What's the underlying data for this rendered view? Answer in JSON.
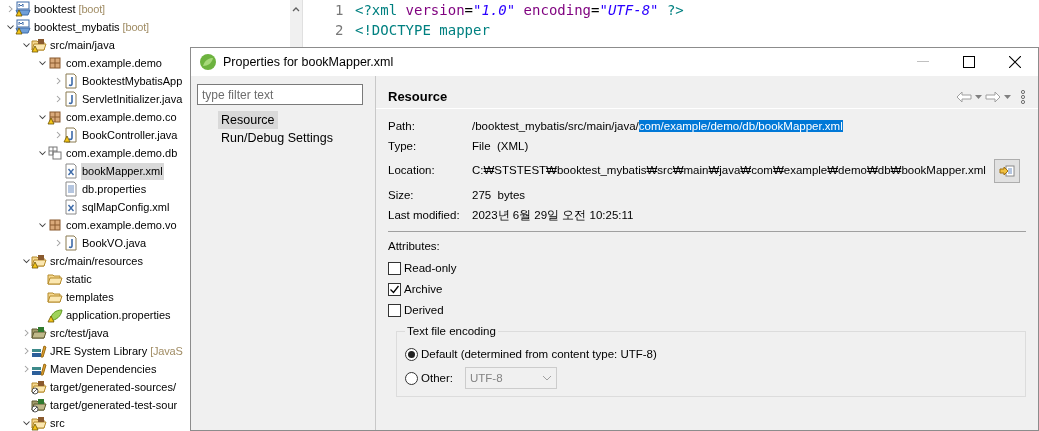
{
  "project_tree": {
    "items": [
      {
        "label": "booktest",
        "suffix": "[boot]",
        "kind": "project",
        "warning": true,
        "expanded": false,
        "selected": false
      },
      {
        "label": "booktest_mybatis",
        "suffix": "[boot]",
        "kind": "project",
        "warning": true,
        "expanded": true,
        "selected": false,
        "children": [
          {
            "label": "src/main/java",
            "kind": "source-folder",
            "warning": true,
            "expanded": true,
            "selected": false,
            "children": [
              {
                "label": "com.example.demo",
                "kind": "package",
                "warning": false,
                "expanded": true,
                "selected": false,
                "children": [
                  {
                    "label": "BooktestMybatisApp",
                    "kind": "java",
                    "warning": false,
                    "expanded": false,
                    "selected": false
                  },
                  {
                    "label": "ServletInitializer.java",
                    "kind": "java",
                    "warning": false,
                    "expanded": false,
                    "selected": false
                  }
                ]
              },
              {
                "label": "com.example.demo.co",
                "kind": "package",
                "warning": true,
                "expanded": true,
                "selected": false,
                "children": [
                  {
                    "label": "BookController.java",
                    "kind": "java",
                    "warning": true,
                    "expanded": false,
                    "selected": false
                  }
                ]
              },
              {
                "label": "com.example.demo.db",
                "kind": "resource-package",
                "warning": false,
                "expanded": true,
                "selected": false,
                "children": [
                  {
                    "label": "bookMapper.xml",
                    "kind": "xml",
                    "warning": false,
                    "selected": true
                  },
                  {
                    "label": "db.properties",
                    "kind": "text",
                    "warning": false,
                    "selected": false
                  },
                  {
                    "label": "sqlMapConfig.xml",
                    "kind": "xml",
                    "warning": false,
                    "selected": false
                  }
                ]
              },
              {
                "label": "com.example.demo.vo",
                "kind": "package",
                "warning": false,
                "expanded": true,
                "selected": false,
                "children": [
                  {
                    "label": "BookVO.java",
                    "kind": "java",
                    "warning": false,
                    "expanded": false,
                    "selected": false
                  }
                ]
              }
            ]
          },
          {
            "label": "src/main/resources",
            "kind": "source-folder",
            "warning": true,
            "expanded": true,
            "selected": false,
            "children": [
              {
                "label": "static",
                "kind": "folder",
                "warning": false,
                "selected": false
              },
              {
                "label": "templates",
                "kind": "folder",
                "warning": false,
                "selected": false
              },
              {
                "label": "application.properties",
                "kind": "spring",
                "warning": true,
                "selected": false
              }
            ]
          },
          {
            "label": "src/test/java",
            "kind": "test-folder",
            "warning": false,
            "expanded": false,
            "selected": false
          },
          {
            "label": "JRE System Library",
            "suffix": "[JavaS",
            "kind": "library",
            "warning": false,
            "expanded": false,
            "selected": false
          },
          {
            "label": "Maven Dependencies",
            "kind": "library",
            "warning": false,
            "expanded": false,
            "selected": false
          },
          {
            "label": "target/generated-sources/",
            "kind": "source-folder-off",
            "warning": false,
            "selected": false
          },
          {
            "label": "target/generated-test-sour",
            "kind": "test-folder-off",
            "warning": false,
            "selected": false
          },
          {
            "label": "src",
            "kind": "source-folder",
            "warning": true,
            "expanded": true,
            "selected": false
          }
        ]
      }
    ]
  },
  "editor": {
    "lines": [
      {
        "number": "1",
        "tokens": [
          {
            "text": "<?xml ",
            "kind": "tag"
          },
          {
            "text": "version",
            "kind": "attr"
          },
          {
            "text": "=",
            "kind": "plain"
          },
          {
            "text": "\"1.0\"",
            "kind": "string"
          },
          {
            "text": " encoding",
            "kind": "attr"
          },
          {
            "text": "=",
            "kind": "plain"
          },
          {
            "text": "\"UTF-8\"",
            "kind": "string"
          },
          {
            "text": " ?>",
            "kind": "tag"
          }
        ]
      },
      {
        "number": "2",
        "tokens": [
          {
            "text": "<!DOCTYPE mapper",
            "kind": "tag"
          }
        ]
      }
    ]
  },
  "dialog": {
    "title": "Properties for bookMapper.xml",
    "filter": {
      "placeholder": "type filter text"
    },
    "nav": [
      {
        "label": "Resource",
        "selected": true
      },
      {
        "label": "Run/Debug Settings",
        "selected": false
      }
    ],
    "page": {
      "title": "Resource",
      "fields": [
        {
          "label": "Path:",
          "value": [
            {
              "text": "/booktest_mybatis/src/main/java/",
              "highlighted": false
            },
            {
              "text": "com/example/demo/db/bookMapper.xml",
              "highlighted": true
            }
          ]
        },
        {
          "label": "Type:",
          "value": [
            {
              "text": "File  (XML)",
              "highlighted": false
            }
          ]
        },
        {
          "label": "Location:",
          "value": [
            {
              "text": "C:₩STSTEST₩booktest_mybatis₩src₩main₩java₩com₩example₩demo₩db₩bookMapper.xml",
              "highlighted": false
            }
          ],
          "kind": "location"
        },
        {
          "label": "Size:",
          "value": [
            {
              "text": "275  bytes",
              "highlighted": false
            }
          ]
        },
        {
          "label": "Last modified:",
          "value": [
            {
              "text": "2023년 6월 29일 오전 10:25:11",
              "highlighted": false
            }
          ]
        }
      ],
      "attributes_label": "Attributes:",
      "attributes": [
        {
          "label": "Read-only",
          "checked": false
        },
        {
          "label": "Archive",
          "checked": true
        },
        {
          "label": "Derived",
          "checked": false
        }
      ],
      "encoding": {
        "title": "Text file encoding",
        "options": [
          {
            "label": "Default (determined from content type: UTF-8)",
            "selected": true
          },
          {
            "label": "Other:",
            "selected": false
          }
        ],
        "other_value": "UTF-8"
      }
    }
  }
}
